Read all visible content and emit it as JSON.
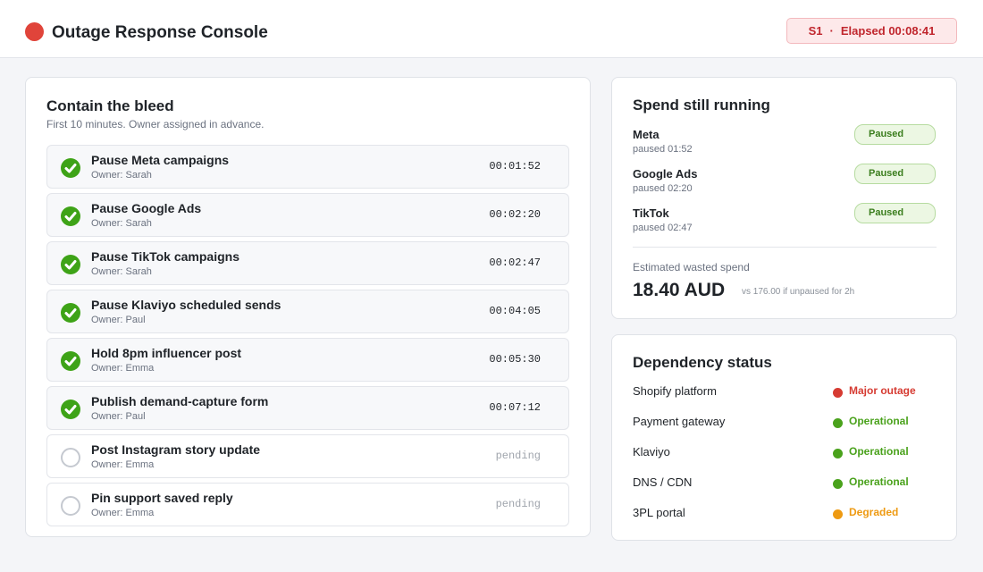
{
  "header": {
    "app_title": "Outage Response Console",
    "severity": "S1",
    "separator": "·",
    "elapsed": "Elapsed 00:08:41"
  },
  "contain": {
    "title": "Contain the bleed",
    "subtitle": "First 10 minutes. Owner assigned in advance.",
    "tasks": [
      {
        "name": "Pause Meta campaigns",
        "owner": "Owner: Sarah",
        "time": "00:01:52",
        "status": "done"
      },
      {
        "name": "Pause Google Ads",
        "owner": "Owner: Sarah",
        "time": "00:02:20",
        "status": "done"
      },
      {
        "name": "Pause TikTok campaigns",
        "owner": "Owner: Sarah",
        "time": "00:02:47",
        "status": "done"
      },
      {
        "name": "Pause Klaviyo scheduled sends",
        "owner": "Owner: Paul",
        "time": "00:04:05",
        "status": "done"
      },
      {
        "name": "Hold 8pm influencer post",
        "owner": "Owner: Emma",
        "time": "00:05:30",
        "status": "done"
      },
      {
        "name": "Publish demand-capture form",
        "owner": "Owner: Paul",
        "time": "00:07:12",
        "status": "done"
      },
      {
        "name": "Post Instagram story update",
        "owner": "Owner: Emma",
        "time": "pending",
        "status": "pending"
      },
      {
        "name": "Pin support saved reply",
        "owner": "Owner: Emma",
        "time": "pending",
        "status": "pending"
      }
    ]
  },
  "spend": {
    "title": "Spend still running",
    "channels": [
      {
        "name": "Meta",
        "meta": "paused 01:52",
        "status": "Paused"
      },
      {
        "name": "Google Ads",
        "meta": "paused 02:20",
        "status": "Paused"
      },
      {
        "name": "TikTok",
        "meta": "paused 02:47",
        "status": "Paused"
      }
    ],
    "waste_label": "Estimated wasted spend",
    "waste_amount": "18.40 AUD",
    "waste_note": "vs 176.00 if unpaused for 2h"
  },
  "dependencies": {
    "title": "Dependency status",
    "items": [
      {
        "name": "Shopify platform",
        "status": "Major outage",
        "color": "#d63b32"
      },
      {
        "name": "Payment gateway",
        "status": "Operational",
        "color": "#4aa21c"
      },
      {
        "name": "Klaviyo",
        "status": "Operational",
        "color": "#4aa21c"
      },
      {
        "name": "DNS / CDN",
        "status": "Operational",
        "color": "#4aa21c"
      },
      {
        "name": "3PL portal",
        "status": "Degraded",
        "color": "#ee9a12"
      }
    ]
  },
  "icons": {
    "live": "recording-dot-icon",
    "done": "check-circle-icon",
    "pending": "empty-circle-icon",
    "status": "status-dot-icon"
  }
}
